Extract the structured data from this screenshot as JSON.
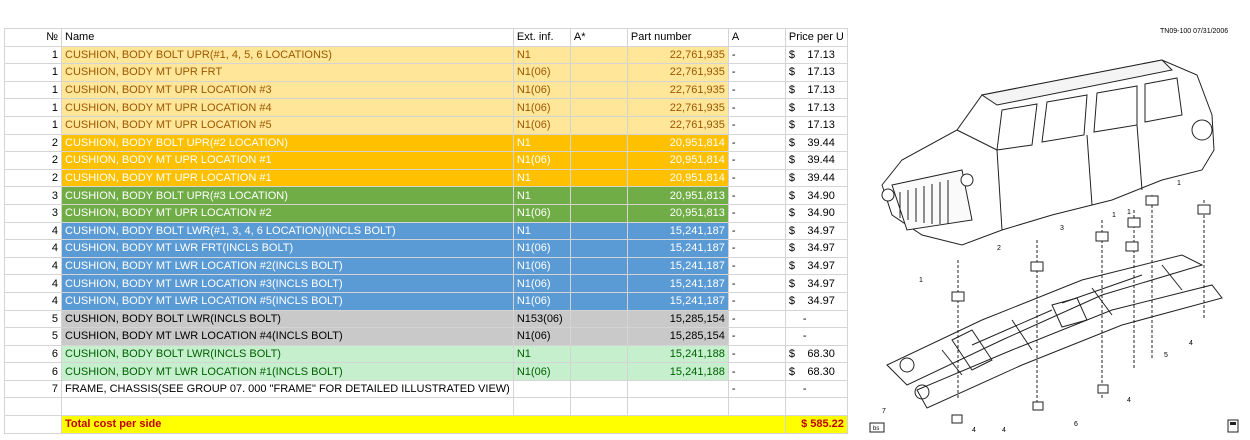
{
  "table": {
    "headers": {
      "num": "№",
      "name": "Name",
      "ext": "Ext. inf.",
      "astar": "A*",
      "part": "Part number",
      "a": "A",
      "price": "Price per U"
    },
    "rows": [
      {
        "num": "1",
        "name": "CUSHION, BODY BOLT UPR(#1, 4, 5, 6 LOCATIONS)",
        "ext": "N1",
        "part": "22,761,935",
        "a": "-",
        "cur": "$",
        "price": "17.13",
        "bg": "#FFE699",
        "fg": "#9C5700"
      },
      {
        "num": "1",
        "name": "CUSHION, BODY MT UPR FRT",
        "ext": "N1(06)",
        "part": "22,761,935",
        "a": "-",
        "cur": "$",
        "price": "17.13",
        "bg": "#FFE699",
        "fg": "#9C5700"
      },
      {
        "num": "1",
        "name": "CUSHION, BODY MT UPR LOCATION #3",
        "ext": "N1(06)",
        "part": "22,761,935",
        "a": "-",
        "cur": "$",
        "price": "17.13",
        "bg": "#FFE699",
        "fg": "#9C5700"
      },
      {
        "num": "1",
        "name": "CUSHION, BODY MT UPR LOCATION #4",
        "ext": "N1(06)",
        "part": "22,761,935",
        "a": "-",
        "cur": "$",
        "price": "17.13",
        "bg": "#FFE699",
        "fg": "#9C5700"
      },
      {
        "num": "1",
        "name": "CUSHION, BODY MT UPR LOCATION #5",
        "ext": "N1(06)",
        "part": "22,761,935",
        "a": "-",
        "cur": "$",
        "price": "17.13",
        "bg": "#FFE699",
        "fg": "#9C5700"
      },
      {
        "num": "2",
        "name": "CUSHION, BODY BOLT UPR(#2 LOCATION)",
        "ext": "N1",
        "part": "20,951,814",
        "a": "-",
        "cur": "$",
        "price": "39.44",
        "bg": "#FFC000",
        "fg": "#FFFFFF"
      },
      {
        "num": "2",
        "name": "CUSHION, BODY MT UPR LOCATION #1",
        "ext": "N1(06)",
        "part": "20,951,814",
        "a": "-",
        "cur": "$",
        "price": "39.44",
        "bg": "#FFC000",
        "fg": "#FFFFFF"
      },
      {
        "num": "2",
        "name": "CUSHION, BODY MT UPR LOCATION #1",
        "ext": "N1",
        "part": "20,951,814",
        "a": "-",
        "cur": "$",
        "price": "39.44",
        "bg": "#FFC000",
        "fg": "#FFFFFF"
      },
      {
        "num": "3",
        "name": "CUSHION, BODY BOLT UPR(#3 LOCATION)",
        "ext": "N1",
        "part": "20,951,813",
        "a": "-",
        "cur": "$",
        "price": "34.90",
        "bg": "#70AD47",
        "fg": "#FFFFFF"
      },
      {
        "num": "3",
        "name": "CUSHION, BODY MT UPR LOCATION #2",
        "ext": "N1(06)",
        "part": "20,951,813",
        "a": "-",
        "cur": "$",
        "price": "34.90",
        "bg": "#70AD47",
        "fg": "#FFFFFF"
      },
      {
        "num": "4",
        "name": "CUSHION, BODY BOLT LWR(#1, 3, 4, 6 LOCATION)(INCLS BOLT)",
        "ext": "N1",
        "part": "15,241,187",
        "a": "-",
        "cur": "$",
        "price": "34.97",
        "bg": "#5B9BD5",
        "fg": "#FFFFFF"
      },
      {
        "num": "4",
        "name": "CUSHION, BODY MT LWR FRT(INCLS BOLT)",
        "ext": "N1(06)",
        "part": "15,241,187",
        "a": "-",
        "cur": "$",
        "price": "34.97",
        "bg": "#5B9BD5",
        "fg": "#FFFFFF"
      },
      {
        "num": "4",
        "name": "CUSHION, BODY MT LWR LOCATION #2(INCLS BOLT)",
        "ext": "N1(06)",
        "part": "15,241,187",
        "a": "-",
        "cur": "$",
        "price": "34.97",
        "bg": "#5B9BD5",
        "fg": "#FFFFFF"
      },
      {
        "num": "4",
        "name": "CUSHION, BODY MT LWR LOCATION #3(INCLS BOLT)",
        "ext": "N1(06)",
        "part": "15,241,187",
        "a": "-",
        "cur": "$",
        "price": "34.97",
        "bg": "#5B9BD5",
        "fg": "#FFFFFF"
      },
      {
        "num": "4",
        "name": "CUSHION, BODY MT LWR LOCATION #5(INCLS BOLT)",
        "ext": "N1(06)",
        "part": "15,241,187",
        "a": "-",
        "cur": "$",
        "price": "34.97",
        "bg": "#5B9BD5",
        "fg": "#FFFFFF"
      },
      {
        "num": "5",
        "name": "CUSHION, BODY BOLT LWR(INCLS BOLT)",
        "ext": "N153(06)",
        "part": "15,285,154",
        "a": "-",
        "cur": "",
        "price": "-",
        "bg": "#C9C9C9",
        "fg": "#000000"
      },
      {
        "num": "5",
        "name": "CUSHION, BODY MT LWR LOCATION #4(INCLS BOLT)",
        "ext": "N1(06)",
        "part": "15,285,154",
        "a": "-",
        "cur": "",
        "price": "-",
        "bg": "#C9C9C9",
        "fg": "#000000"
      },
      {
        "num": "6",
        "name": "CUSHION, BODY BOLT LWR(INCLS BOLT)",
        "ext": "N1",
        "part": "15,241,188",
        "a": "-",
        "cur": "$",
        "price": "68.30",
        "bg": "#C6EFCE",
        "fg": "#006100"
      },
      {
        "num": "6",
        "name": "CUSHION, BODY MT LWR LOCATION #1(INCLS BOLT)",
        "ext": "N1(06)",
        "part": "15,241,188",
        "a": "-",
        "cur": "$",
        "price": "68.30",
        "bg": "#C6EFCE",
        "fg": "#006100"
      },
      {
        "num": "7",
        "name": "FRAME, CHASSIS(SEE GROUP 07. 000 \"FRAME\" FOR DETAILED ILLUSTRATED VIEW)",
        "ext": "",
        "part": "",
        "a": "-",
        "cur": "",
        "price": "-",
        "bg": "#FFFFFF",
        "fg": "#000000"
      }
    ],
    "total": {
      "label": "Total cost per side",
      "value": "$ 585.22",
      "bg": "#FFFF00",
      "fg": "#C00000"
    }
  },
  "drawing": {
    "ref": "TN09-100 07/31/2006",
    "callouts": [
      "1",
      "1",
      "1",
      "2",
      "3",
      "1",
      "4",
      "5",
      "4",
      "6",
      "4",
      "7",
      "4"
    ],
    "corner_box": "bs"
  }
}
